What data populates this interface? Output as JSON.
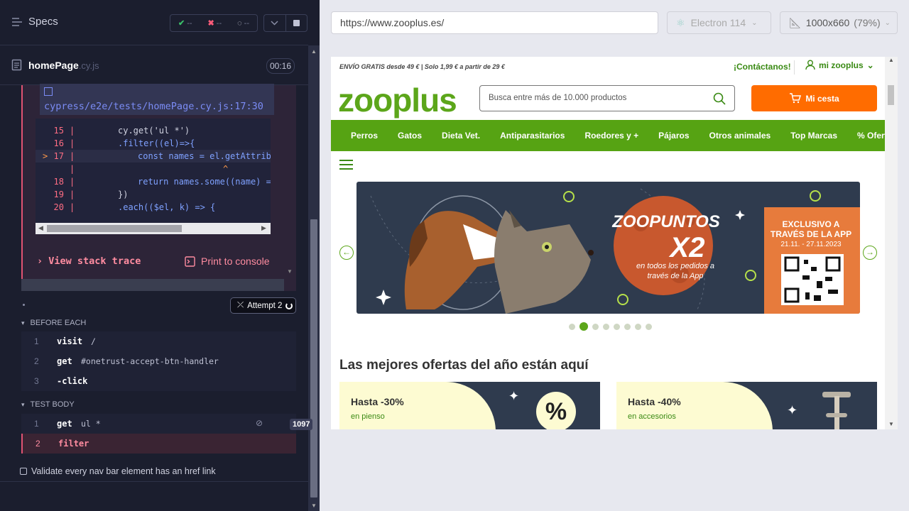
{
  "runner": {
    "specs_label": "Specs",
    "stats": {
      "passed": "--",
      "failed": "--",
      "pending": "--"
    },
    "file": {
      "name": "homePage",
      "ext": ".cy.js",
      "timer": "00:16"
    },
    "error": {
      "path": "cypress/e2e/tests/homePage.cy.js:17:30",
      "code_lines": [
        {
          "num": "15",
          "text": "cy.get('ul *')"
        },
        {
          "num": "16",
          "text": ".filter((el)=>{"
        },
        {
          "num": "17",
          "text": "const names = el.getAttrib"
        },
        {
          "num": "",
          "text": "^"
        },
        {
          "num": "18",
          "text": "return names.some((name) ="
        },
        {
          "num": "19",
          "text": "})"
        },
        {
          "num": "20",
          "text": ".each(($el, k) => {"
        }
      ],
      "stack_trace_label": "View stack trace",
      "print_label": "Print to console"
    },
    "attempt_label": "Attempt 2",
    "before_each": {
      "heading": "BEFORE EACH",
      "commands": [
        {
          "num": "1",
          "name": "visit",
          "arg": "/"
        },
        {
          "num": "2",
          "name": "get",
          "arg": "#onetrust-accept-btn-handler"
        },
        {
          "num": "3",
          "name": "-click",
          "arg": ""
        }
      ]
    },
    "test_body": {
      "heading": "TEST BODY",
      "commands": [
        {
          "num": "1",
          "name": "get",
          "arg": "ul *",
          "badge": "1097"
        },
        {
          "num": "2",
          "name": "filter",
          "arg": ""
        }
      ]
    },
    "test_title": "Validate every nav bar element has an href link"
  },
  "aut": {
    "url": "https://www.zooplus.es/",
    "browser": "Electron 114",
    "viewport": "1000x660",
    "zoom": "(79%)"
  },
  "site": {
    "shipping_note": "ENVÍO GRATIS desde 49 € | Solo 1,99 € a partir de 29 €",
    "contact": "¡Contáctanos!",
    "account": "mi zooplus",
    "logo": "zooplus",
    "search_placeholder": "Busca entre más de 10.000 productos",
    "cart": "Mi cesta",
    "nav": [
      "Perros",
      "Gatos",
      "Dieta Vet.",
      "Antiparasitarios",
      "Roedores y +",
      "Pájaros",
      "Otros animales",
      "Top Marcas",
      "% Ofertas"
    ],
    "banner": {
      "headline": "ZOOPUNTOS",
      "multiplier": "X2",
      "subline1": "en todos los pedidos a",
      "subline2": "través de la App",
      "exclusive1": "EXCLUSIVO A",
      "exclusive2": "TRAVÉS DE LA APP",
      "dates": "21.11. - 27.11.2023"
    },
    "offers_heading": "Las mejores ofertas del año están aquí",
    "cards": [
      {
        "title": "Hasta -30%",
        "subtitle": "en pienso"
      },
      {
        "title": "Hasta -40%",
        "subtitle": "en accesorios"
      }
    ]
  },
  "colors": {
    "brand_green": "#5ca61a",
    "cart_orange": "#ff6c00",
    "error_red": "#e05372"
  }
}
